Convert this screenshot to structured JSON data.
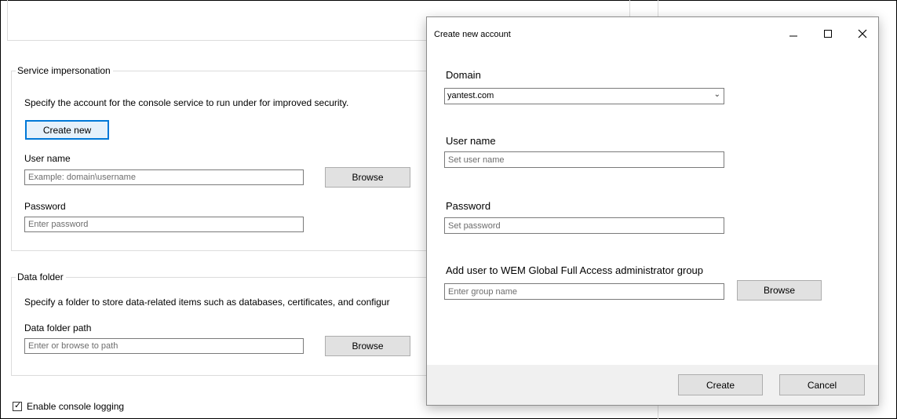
{
  "background": {
    "service_impersonation": {
      "group_label": "Service impersonation",
      "description": "Specify the account for the console service to run under for improved security.",
      "create_new_label": "Create new",
      "username_label": "User name",
      "username_placeholder": "Example: domain\\username",
      "browse_label": "Browse",
      "password_label": "Password",
      "password_placeholder": "Enter password"
    },
    "data_folder": {
      "group_label": "Data folder",
      "description": "Specify a folder to store data-related items such as databases, certificates, and configur",
      "path_label": "Data folder path",
      "path_placeholder": "Enter or browse to path",
      "browse_label": "Browse"
    },
    "logging": {
      "label": "Enable console logging",
      "checked": true
    }
  },
  "dialog": {
    "title": "Create new account",
    "minimize_icon": "minimize-icon",
    "maximize_icon": "maximize-icon",
    "close_icon": "close-icon",
    "domain_label": "Domain",
    "domain_value": "yantest.com",
    "username_label": "User name",
    "username_placeholder": "Set user name",
    "password_label": "Password",
    "password_placeholder": "Set password",
    "group_label": "Add user to WEM Global Full Access administrator group",
    "group_placeholder": "Enter group name",
    "browse_label": "Browse",
    "create_label": "Create",
    "cancel_label": "Cancel"
  },
  "colors": {
    "accent": "#0078d7",
    "button_face": "#e1e1e1",
    "footer": "#f0f0f0",
    "border": "#dcdcdc"
  }
}
